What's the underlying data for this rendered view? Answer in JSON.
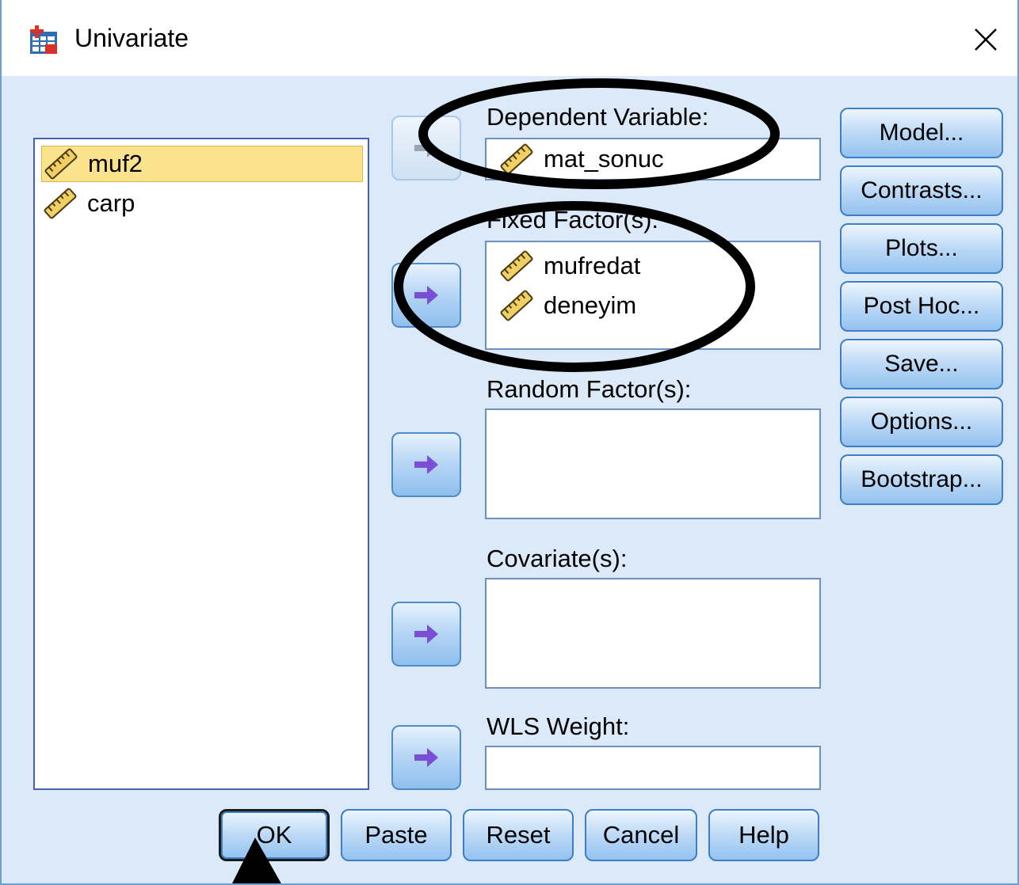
{
  "window": {
    "title": "Univariate",
    "close_glyph": "✕"
  },
  "source_list": {
    "items": [
      {
        "label": "muf2",
        "selected": true
      },
      {
        "label": "carp",
        "selected": false
      }
    ]
  },
  "fields": {
    "dependent": {
      "label": "Dependent Variable:",
      "items": [
        "mat_sonuc"
      ]
    },
    "fixed": {
      "label": "Fixed Factor(s):",
      "items": [
        "mufredat",
        "deneyim"
      ]
    },
    "random": {
      "label": "Random Factor(s):",
      "items": []
    },
    "covariate": {
      "label": "Covariate(s):",
      "items": []
    },
    "wls": {
      "label": "WLS Weight:",
      "items": []
    }
  },
  "side_buttons": [
    "Model...",
    "Contrasts...",
    "Plots...",
    "Post Hoc...",
    "Save...",
    "Options...",
    "Bootstrap..."
  ],
  "bottom_buttons": [
    "OK",
    "Paste",
    "Reset",
    "Cancel",
    "Help"
  ],
  "colors": {
    "dialog_bg": "#dbe9f8",
    "selection": "#fbe28c",
    "arrow_glyph": "#7a4fd6",
    "annotation": "#000000"
  },
  "icons": {
    "variable": "ruler-icon",
    "move": "right-arrow-icon",
    "app": "spss-table-icon"
  }
}
